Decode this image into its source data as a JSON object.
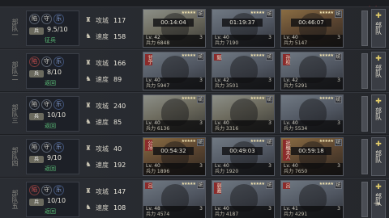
{
  "close_icon": "×",
  "party_button_label": "部队",
  "party_icon": "✚",
  "bottom_icon": "⇥",
  "stat_labels": {
    "siege": "攻城",
    "speed": "速度"
  },
  "rows": [
    {
      "side_label": "部队一",
      "icons": [
        {
          "glyph": "陷",
          "color": "grey"
        },
        {
          "glyph": "守",
          "color": "grey"
        },
        {
          "glyph": "乐",
          "color": "blue"
        }
      ],
      "soldier_badge": "兵",
      "count": "9.5/10",
      "status": "征兵",
      "siege": "117",
      "speed": "158",
      "cards": [
        {
          "theme": "lit",
          "name": "",
          "stars": "★★★★★",
          "tag": "统",
          "timer": "00:14:04",
          "level": "Lv. 42",
          "sub": "3",
          "troops": "兵力 6848"
        },
        {
          "theme": "cold",
          "name": "",
          "stars": "★★★★★",
          "tag": "统",
          "timer": "01:19:37",
          "level": "Lv. 40",
          "sub": "3",
          "troops": "兵力 7190"
        },
        {
          "theme": "warm",
          "name": "",
          "stars": "★★★★★",
          "tag": "统",
          "timer": "00:46:07",
          "level": "Lv. 40",
          "sub": "3",
          "troops": "兵力 5147"
        }
      ]
    },
    {
      "side_label": "部队二",
      "icons": [
        {
          "glyph": "陷",
          "color": "red"
        },
        {
          "glyph": "守",
          "color": "grey"
        },
        {
          "glyph": "乐",
          "color": "blue"
        }
      ],
      "soldier_badge": "兵",
      "count": "8/10",
      "status": "返回",
      "siege": "166",
      "speed": "89",
      "cards": [
        {
          "theme": "cold",
          "name": "甘宁",
          "stars": "★★★★★",
          "tag": "统",
          "timer": "",
          "level": "Lv. 40",
          "sub": "3",
          "troops": "兵力 5947"
        },
        {
          "theme": "cold",
          "name": "甄",
          "stars": "★★★★★",
          "tag": "统",
          "timer": "",
          "level": "Lv. 42",
          "sub": "3",
          "troops": "兵力 3501"
        },
        {
          "theme": "cold",
          "name": "孙权",
          "stars": "★★★★★",
          "tag": "统",
          "timer": "",
          "level": "Lv. 42",
          "sub": "3",
          "troops": "兵力 5291"
        }
      ]
    },
    {
      "side_label": "部队三",
      "icons": [
        {
          "glyph": "陷",
          "color": "grey"
        },
        {
          "glyph": "守",
          "color": "grey"
        },
        {
          "glyph": "乐",
          "color": "blue"
        }
      ],
      "soldier_badge": "兵",
      "count": "10/10",
      "status": "返回",
      "siege": "240",
      "speed": "85",
      "cards": [
        {
          "theme": "lit",
          "name": "",
          "stars": "★★★★★",
          "tag": "统",
          "timer": "",
          "level": "Lv. 40",
          "sub": "3",
          "troops": "兵力 6136"
        },
        {
          "theme": "lit",
          "name": "",
          "stars": "★★★★★",
          "tag": "统",
          "timer": "",
          "level": "Lv. 40",
          "sub": "3",
          "troops": "兵力 3316"
        },
        {
          "theme": "cold",
          "name": "",
          "stars": "★★★★★",
          "tag": "统",
          "timer": "",
          "level": "Lv. 40",
          "sub": "3",
          "troops": "兵力 5534"
        }
      ]
    },
    {
      "side_label": "部队四",
      "icons": [
        {
          "glyph": "陷",
          "color": "grey"
        },
        {
          "glyph": "守",
          "color": "grey"
        },
        {
          "glyph": "乐",
          "color": "blue"
        }
      ],
      "soldier_badge": "兵",
      "count": "9/10",
      "status": "返回",
      "siege": "40",
      "speed": "192",
      "cards": [
        {
          "theme": "warm",
          "name": "公孙",
          "stars": "★★★★★",
          "tag": "统",
          "timer": "00:54:32",
          "level": "Lv. 40",
          "sub": "3",
          "troops": "兵力 1896"
        },
        {
          "theme": "cold",
          "name": "",
          "stars": "★★★★★",
          "tag": "统",
          "timer": "00:49:03",
          "level": "Lv. 40",
          "sub": "3",
          "troops": "兵力 1920"
        },
        {
          "theme": "warm",
          "name": "祝融夫人",
          "stars": "★★★★★",
          "tag": "统",
          "timer": "00:59:18",
          "level": "Lv. 40",
          "sub": "3",
          "troops": "兵力 7650"
        }
      ]
    },
    {
      "side_label": "部队五",
      "icons": [
        {
          "glyph": "陷",
          "color": "red"
        },
        {
          "glyph": "守",
          "color": "grey"
        },
        {
          "glyph": "乐",
          "color": "blue"
        }
      ],
      "soldier_badge": "兵",
      "count": "10/10",
      "status": "返回",
      "siege": "147",
      "speed": "108",
      "cards": [
        {
          "theme": "cold",
          "name": "吕",
          "stars": "★★★★★",
          "tag": "统",
          "timer": "",
          "level": "Lv. 48",
          "sub": "3",
          "troops": "兵力 4574"
        },
        {
          "theme": "cold",
          "name": "郭嘉",
          "stars": "★★★★★",
          "tag": "统",
          "timer": "",
          "level": "Lv. 40",
          "sub": "3",
          "troops": "兵力 4187"
        },
        {
          "theme": "cold",
          "name": "吕",
          "stars": "★★★★★",
          "tag": "统",
          "timer": "",
          "level": "Lv. 41",
          "sub": "3",
          "troops": "兵力 4291"
        }
      ]
    }
  ]
}
